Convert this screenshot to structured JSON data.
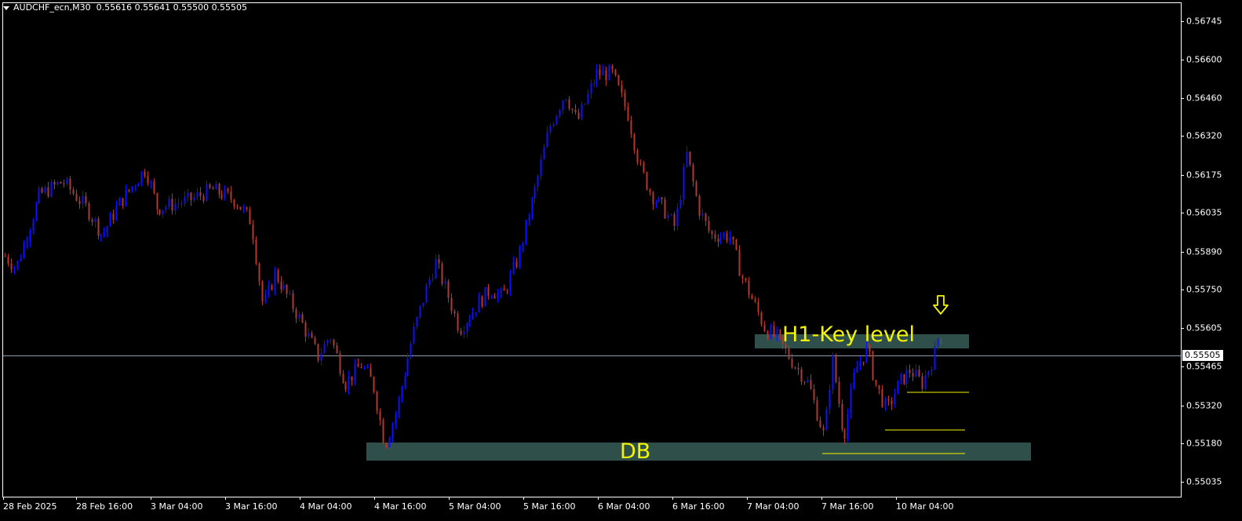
{
  "header": {
    "symbol": "AUDCHF_ecn,M30",
    "ohlc": "0.55616 0.55641 0.55500 0.55505"
  },
  "price_axis": {
    "labels": [
      "0.56745",
      "0.56600",
      "0.56460",
      "0.56320",
      "0.56175",
      "0.56035",
      "0.55890",
      "0.55750",
      "0.55605",
      "0.55465",
      "0.55320",
      "0.55180",
      "0.55035"
    ],
    "current_price": "0.55505"
  },
  "time_axis": {
    "labels": [
      "28 Feb 2025",
      "28 Feb 16:00",
      "3 Mar 04:00",
      "3 Mar 16:00",
      "4 Mar 04:00",
      "4 Mar 16:00",
      "5 Mar 04:00",
      "5 Mar 16:00",
      "6 Mar 04:00",
      "6 Mar 16:00",
      "7 Mar 04:00",
      "7 Mar 16:00",
      "10 Mar 04:00"
    ]
  },
  "annotations": {
    "db_label": "DB",
    "key_label": "H1-Key level",
    "arrow": "down-arrow-icon"
  },
  "colors": {
    "background": "#000000",
    "bull_candle": "#1010ff",
    "bear_candle": "#b03a30",
    "zone_fill": "#2e4f4a",
    "annotation": "#f5f500",
    "bid_line": "#8899aa"
  },
  "chart_data": {
    "type": "candlestick",
    "title": "AUDCHF_ecn,M30",
    "ylim": [
      0.5497,
      0.5679
    ],
    "last_price": 0.55505,
    "zones": [
      {
        "name": "DB",
        "from": 0.5511,
        "to": 0.5514
      },
      {
        "name": "H1-Key level",
        "from": 0.5553,
        "to": 0.5555
      }
    ],
    "price_path": [
      [
        0,
        0.5589
      ],
      [
        20,
        0.5583
      ],
      [
        50,
        0.561
      ],
      [
        80,
        0.5615
      ],
      [
        110,
        0.5605
      ],
      [
        130,
        0.5595
      ],
      [
        150,
        0.5606
      ],
      [
        185,
        0.562
      ],
      [
        200,
        0.5605
      ],
      [
        240,
        0.5608
      ],
      [
        270,
        0.5612
      ],
      [
        300,
        0.5608
      ],
      [
        320,
        0.56
      ],
      [
        335,
        0.5568
      ],
      [
        350,
        0.5581
      ],
      [
        380,
        0.5565
      ],
      [
        405,
        0.555
      ],
      [
        420,
        0.5558
      ],
      [
        440,
        0.554
      ],
      [
        460,
        0.5547
      ],
      [
        475,
        0.554
      ],
      [
        490,
        0.5517
      ],
      [
        505,
        0.553
      ],
      [
        525,
        0.5557
      ],
      [
        545,
        0.5577
      ],
      [
        555,
        0.5585
      ],
      [
        570,
        0.5573
      ],
      [
        585,
        0.556
      ],
      [
        610,
        0.557
      ],
      [
        625,
        0.5575
      ],
      [
        640,
        0.5572
      ],
      [
        660,
        0.5587
      ],
      [
        680,
        0.561
      ],
      [
        700,
        0.5635
      ],
      [
        720,
        0.5648
      ],
      [
        735,
        0.5637
      ],
      [
        760,
        0.5655
      ],
      [
        780,
        0.5655
      ],
      [
        800,
        0.564
      ],
      [
        815,
        0.562
      ],
      [
        830,
        0.561
      ],
      [
        845,
        0.5605
      ],
      [
        860,
        0.5598
      ],
      [
        875,
        0.5625
      ],
      [
        890,
        0.5605
      ],
      [
        905,
        0.5595
      ],
      [
        930,
        0.5595
      ],
      [
        945,
        0.558
      ],
      [
        960,
        0.557
      ],
      [
        975,
        0.556
      ],
      [
        990,
        0.5557
      ],
      [
        1010,
        0.5548
      ],
      [
        1030,
        0.554
      ],
      [
        1050,
        0.552
      ],
      [
        1060,
        0.555
      ],
      [
        1075,
        0.552
      ],
      [
        1090,
        0.5545
      ],
      [
        1105,
        0.5553
      ],
      [
        1115,
        0.554
      ],
      [
        1130,
        0.553
      ],
      [
        1145,
        0.554
      ],
      [
        1160,
        0.5545
      ],
      [
        1175,
        0.554
      ],
      [
        1190,
        0.555
      ],
      [
        1198,
        0.5561
      ],
      [
        1202,
        0.5551
      ]
    ]
  }
}
